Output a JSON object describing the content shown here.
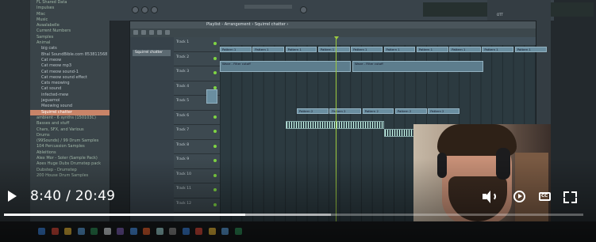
{
  "browser": {
    "items": [
      {
        "label": "FL Shared Data",
        "type": "folder"
      },
      {
        "label": "Impulses",
        "type": "folder"
      },
      {
        "label": "Misc",
        "type": "folder"
      },
      {
        "label": "Music",
        "type": "folder"
      },
      {
        "label": "Avaalabelle",
        "type": "folder"
      },
      {
        "label": "Current Numbers",
        "type": "folder"
      },
      {
        "label": "Samples",
        "type": "folder"
      },
      {
        "label": "Animal",
        "type": "folder"
      },
      {
        "label": "big cats",
        "type": "file"
      },
      {
        "label": "Bhal SoundBible.com 853811568",
        "type": "file"
      },
      {
        "label": "Cat meow",
        "type": "file"
      },
      {
        "label": "Cat meow mp3",
        "type": "file"
      },
      {
        "label": "Cat meow sound-1",
        "type": "file"
      },
      {
        "label": "Cat meow sound effect",
        "type": "file"
      },
      {
        "label": "Cats meowing",
        "type": "file"
      },
      {
        "label": "Cat sound",
        "type": "file"
      },
      {
        "label": "infected-mew",
        "type": "file"
      },
      {
        "label": "jaguarnoi",
        "type": "file"
      },
      {
        "label": "Meowing sound",
        "type": "file"
      },
      {
        "label": "Squirrel chatter",
        "type": "selected"
      },
      {
        "label": "ambient - 6 synths (150103C)",
        "type": "folder"
      },
      {
        "label": "Basses and stuff",
        "type": "folder"
      },
      {
        "label": "Chars, SFX, and Various",
        "type": "folder"
      },
      {
        "label": "Drums",
        "type": "folder"
      },
      {
        "label": "(99Sounds) / 99 Drum Samples",
        "type": "folder"
      },
      {
        "label": "104 Percussion Samples",
        "type": "folder"
      },
      {
        "label": "Ableitions",
        "type": "folder"
      },
      {
        "label": "Alex Mor - Soler (Sample Pack)",
        "type": "folder"
      },
      {
        "label": "Aoes Huge Dubs Drumstep pack",
        "type": "folder"
      },
      {
        "label": "Dubstep - Drumstep",
        "type": "folder"
      },
      {
        "label": "200 House Drum Samples",
        "type": "folder"
      }
    ]
  },
  "playlist": {
    "title": "Playlist - Arrangement › Squirrel chatter ›",
    "picker_selected": "Squirrel chatter",
    "tracks": [
      "Track 1",
      "Track 2",
      "Track 3",
      "Track 4",
      "Track 5",
      "Track 6",
      "Track 7",
      "Track 8",
      "Track 9",
      "Track 10",
      "Track 11",
      "Track 12"
    ],
    "clips": [
      {
        "label": "Pattern 1",
        "track": 0
      },
      {
        "label": "Pattern 1",
        "track": 0
      },
      {
        "label": "Pattern 1",
        "track": 0
      },
      {
        "label": "Pattern 1",
        "track": 0
      },
      {
        "label": "Pattern 1",
        "track": 0
      },
      {
        "label": "Pattern 1",
        "track": 0
      },
      {
        "label": "Pattern 1",
        "track": 0
      },
      {
        "label": "Pattern 1",
        "track": 0
      },
      {
        "label": "Pattern 1",
        "track": 0
      },
      {
        "label": "Pattern 1",
        "track": 0
      }
    ],
    "automation_clips": [
      "Wave - Filter cutoff",
      "Wave - Filter cutoff"
    ],
    "track5_clips": [
      "Pattern 2",
      "Pattern 2",
      "Pattern 2",
      "Pattern 2",
      "Pattern 2"
    ]
  },
  "toolbar": {
    "pattern_label": "Pattern 1",
    "panel_label": "OTT"
  },
  "player": {
    "time_display": "8:40 / 20:49",
    "progress_played": 0.416,
    "progress_buffered": 0.565,
    "icons": [
      "play-icon",
      "volume-icon",
      "playback-speed-icon",
      "captions-icon",
      "fullscreen-icon"
    ]
  }
}
